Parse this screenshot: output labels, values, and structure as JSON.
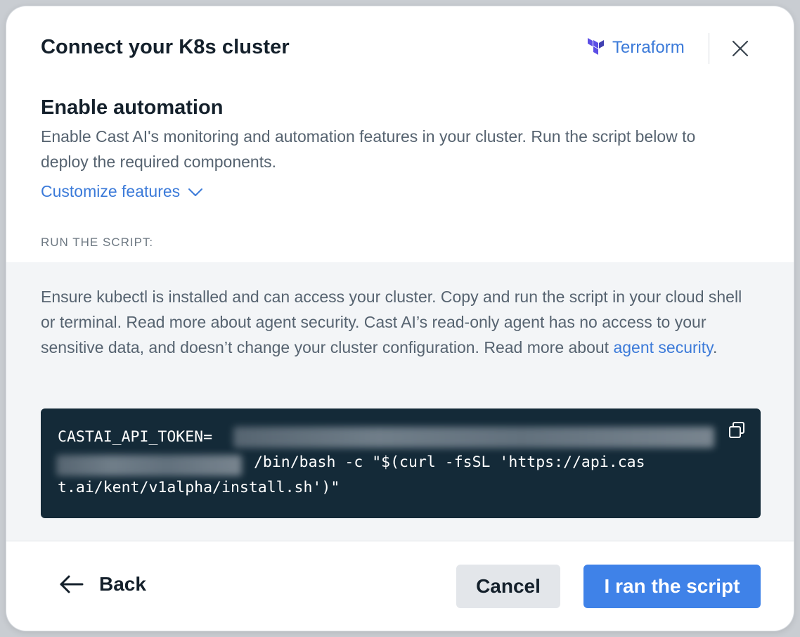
{
  "modal": {
    "title": "Connect your K8s cluster",
    "terraform_label": "Terraform",
    "close_icon": "close-icon"
  },
  "automation": {
    "heading": "Enable automation",
    "description": "Enable Cast AI's monitoring and automation features in your cluster. Run the script below to deploy the required components.",
    "customize_label": "Customize features"
  },
  "script": {
    "section_label": "RUN THE SCRIPT:",
    "info_text": "Ensure kubectl is installed and can access your cluster. Copy and run the script in your cloud shell or terminal. Read more about agent security. Cast AI’s read-only agent has no access to your sensitive data, and doesn’t change your cluster configuration. Read more about ",
    "info_link": "agent security",
    "info_end": ".",
    "code_line1": "CASTAI_API_TOKEN=",
    "code_line2": " /bin/bash -c \"$(curl -fsSL 'https://api.cas",
    "code_line3": "t.ai/kent/v1alpha/install.sh')\"",
    "copy_icon": "copy-icon"
  },
  "footer": {
    "back_label": "Back",
    "cancel_label": "Cancel",
    "primary_label": "I ran the script"
  },
  "colors": {
    "accent": "#3f82e8",
    "link": "#3b7ad9",
    "code_bg": "#142a38",
    "panel_bg": "#f3f5f7",
    "text_dark": "#14202b",
    "text_muted": "#566370"
  }
}
